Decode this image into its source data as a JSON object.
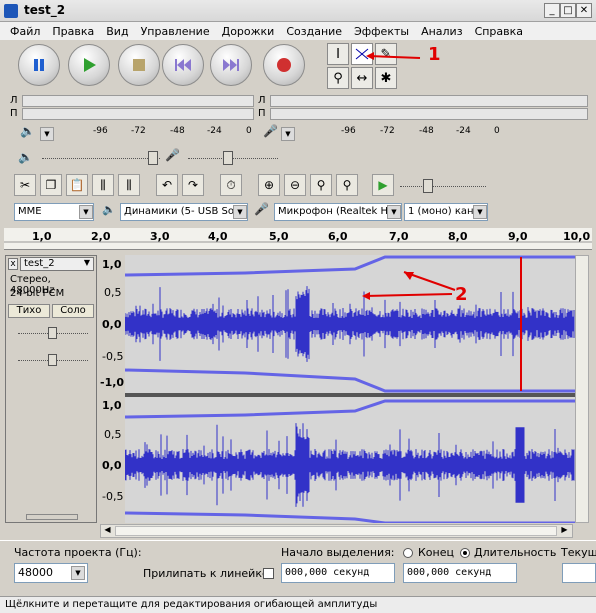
{
  "window": {
    "title": "test_2",
    "min": "_",
    "max": "□",
    "close": "✕"
  },
  "menu": [
    "Файл",
    "Правка",
    "Вид",
    "Управление",
    "Дорожки",
    "Создание",
    "Эффекты",
    "Анализ",
    "Справка"
  ],
  "meters": {
    "left": "Л",
    "right": "П",
    "scale": [
      "-96",
      "-72",
      "-48",
      "-24",
      "0"
    ]
  },
  "devices": {
    "host": "MME",
    "output": "Динамики (5- USB Sour",
    "input": "Микрофон (Realtek Hig",
    "channels": "1 (моно) кана"
  },
  "ruler": [
    "1,0",
    "2,0",
    "3,0",
    "4,0",
    "5,0",
    "6,0",
    "7,0",
    "8,0",
    "9,0",
    "10,0"
  ],
  "track": {
    "name": "test_2",
    "info1": "Стерео, 48000Hz",
    "info2": "24-bit PCM",
    "mute": "Тихо",
    "solo": "Соло",
    "close": "x",
    "yticks": [
      "1,0",
      "0,5",
      "0,0",
      "-0,5",
      "-1,0"
    ]
  },
  "annotations": {
    "one": "1",
    "two": "2"
  },
  "status": {
    "rate_label": "Частота проекта (Гц):",
    "rate_value": "48000",
    "snap_label": "Прилипать к линейке",
    "sel_start": "Начало выделения:",
    "end": "Конец",
    "length": "Длительность",
    "current": "Текущ",
    "time1": "000,000 секунд",
    "time2": "000,000 секунд"
  },
  "statusbar": "Щёлкните и перетащите для редактирования огибающей амплитуды",
  "colors": {
    "wave": "#3232c8",
    "envelope": "#6464e6",
    "playhead": "#e00000",
    "selection_bg": "#d8d8d8"
  }
}
